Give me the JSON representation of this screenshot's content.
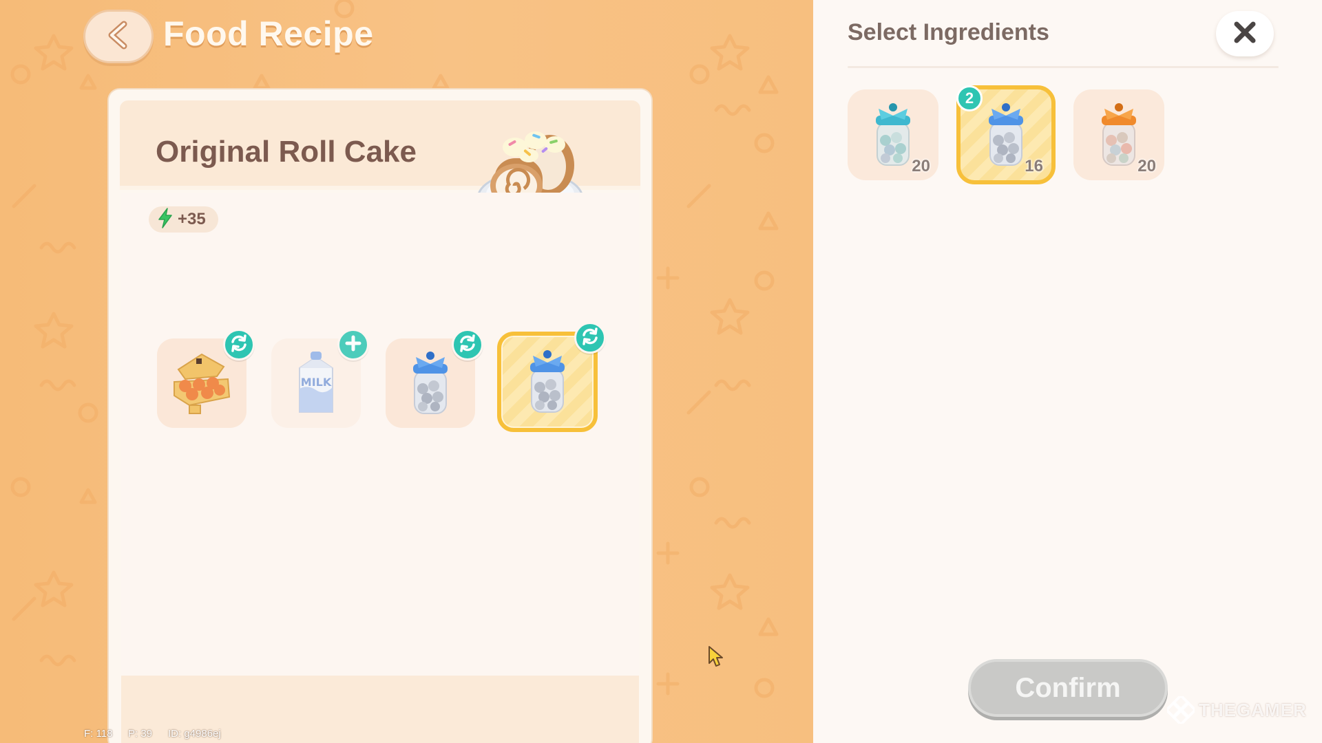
{
  "header": {
    "title": "Food Recipe"
  },
  "recipe": {
    "name": "Original Roll Cake",
    "energy": "+35",
    "slots": [
      {
        "item": "egg-carton",
        "action": "swap-icon",
        "selected": false
      },
      {
        "item": "milk-carton",
        "action": "plus-icon",
        "selected": false,
        "label": "MILK"
      },
      {
        "item": "blue-candy-jar",
        "action": "swap-icon",
        "selected": false
      },
      {
        "item": "blue-candy-jar",
        "action": "swap-icon",
        "selected": true
      }
    ]
  },
  "debug": {
    "f": "F: 118",
    "p": "P: 39",
    "id": "ID: g4986ej"
  },
  "panel": {
    "title": "Select Ingredients",
    "options": [
      {
        "item": "teal-candy-jar",
        "count": "20",
        "selected": false
      },
      {
        "item": "blue-candy-jar",
        "count": "16",
        "selected": true,
        "selected_count": "2"
      },
      {
        "item": "orange-candy-jar",
        "count": "20",
        "selected": false
      }
    ],
    "confirm_label": "Confirm"
  },
  "watermark": "THEGAMER",
  "colors": {
    "accent_teal": "#2ec5b2",
    "highlight_gold": "#f7c03a",
    "background_orange": "#f7bd7a",
    "disabled_button": "#c9c9c7"
  }
}
